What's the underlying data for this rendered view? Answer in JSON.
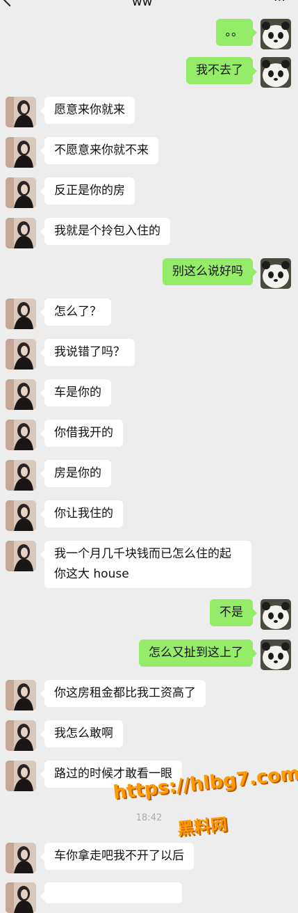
{
  "header": {
    "title": "ww"
  },
  "colors": {
    "incoming": "#ffffff",
    "outgoing": "#95ec69",
    "background": "#ededed"
  },
  "messages": [
    {
      "side": "out",
      "text": "。。"
    },
    {
      "side": "out",
      "text": "我不去了"
    },
    {
      "side": "in",
      "text": "愿意来你就来"
    },
    {
      "side": "in",
      "text": "不愿意来你就不来"
    },
    {
      "side": "in",
      "text": "反正是你的房"
    },
    {
      "side": "in",
      "text": "我就是个拎包入住的"
    },
    {
      "side": "out",
      "text": "别这么说好吗"
    },
    {
      "side": "in",
      "text": "怎么了？"
    },
    {
      "side": "in",
      "text": "我说错了吗？"
    },
    {
      "side": "in",
      "text": "车是你的"
    },
    {
      "side": "in",
      "text": "你借我开的"
    },
    {
      "side": "in",
      "text": "房是你的"
    },
    {
      "side": "in",
      "text": "你让我住的"
    },
    {
      "side": "in",
      "text": "我一个月几千块钱而已怎么住的起你这大 house"
    },
    {
      "side": "out",
      "text": "不是"
    },
    {
      "side": "out",
      "text": "怎么又扯到这上了"
    },
    {
      "side": "in",
      "text": "你这房租金都比我工资高了"
    },
    {
      "side": "in",
      "text": "我怎么敢啊"
    },
    {
      "side": "in",
      "text": "路过的时候才敢看一眼"
    },
    {
      "side": "in",
      "text": "车你拿走吧我不开了以后"
    }
  ],
  "timestamp": "18:42",
  "watermark": {
    "line1": "https://hlbg7.com",
    "line2": "黑料网"
  }
}
